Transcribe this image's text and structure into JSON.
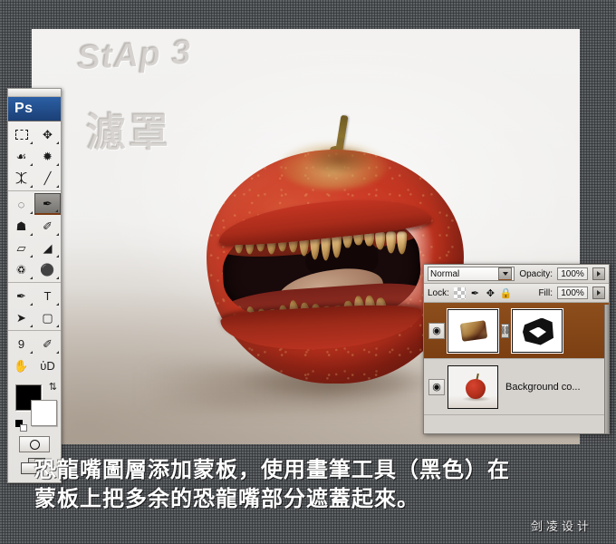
{
  "app": {
    "logo": "Ps"
  },
  "toolbar": {
    "groups": [
      {
        "name": "selection-tools",
        "rows": [
          [
            {
              "name": "rectangular-marquee-tool",
              "icon": "marquee-icon",
              "glyph": "",
              "corner": true,
              "active": false
            },
            {
              "name": "move-tool",
              "icon": "move-icon",
              "glyph": "✥",
              "corner": true,
              "active": false
            }
          ],
          [
            {
              "name": "lasso-tool",
              "icon": "lasso-icon",
              "glyph": "☙",
              "corner": true,
              "active": false
            },
            {
              "name": "magic-wand-tool",
              "icon": "magic-wand-icon",
              "glyph": "✹",
              "corner": true,
              "active": false
            }
          ],
          [
            {
              "name": "crop-tool",
              "icon": "crop-icon",
              "glyph": "⯰",
              "corner": true,
              "active": false
            },
            {
              "name": "slice-tool",
              "icon": "knife-icon",
              "glyph": "╱",
              "corner": true,
              "active": false
            }
          ]
        ]
      },
      {
        "name": "retouch-paint-tools",
        "rows": [
          [
            {
              "name": "healing-brush-tool",
              "icon": "patch-icon",
              "glyph": "◌",
              "corner": true,
              "active": false
            },
            {
              "name": "brush-tool",
              "icon": "brush-icon",
              "glyph": "✒",
              "corner": true,
              "active": true
            }
          ],
          [
            {
              "name": "clone-stamp-tool",
              "icon": "stamp-icon",
              "glyph": "☗",
              "corner": true,
              "active": false
            },
            {
              "name": "history-brush-tool",
              "icon": "history-brush-icon",
              "glyph": "✐",
              "corner": true,
              "active": false
            }
          ],
          [
            {
              "name": "eraser-tool",
              "icon": "eraser-icon",
              "glyph": "▱",
              "corner": true,
              "active": false
            },
            {
              "name": "gradient-tool",
              "icon": "paint-bucket-icon",
              "glyph": "◢",
              "corner": true,
              "active": false
            }
          ],
          [
            {
              "name": "blur-tool",
              "icon": "blur-drop-icon",
              "glyph": "♽",
              "corner": true,
              "active": false
            },
            {
              "name": "dodge-tool",
              "icon": "dodge-icon",
              "glyph": "⚫",
              "corner": true,
              "active": false
            }
          ]
        ]
      },
      {
        "name": "vector-type-tools",
        "rows": [
          [
            {
              "name": "pen-tool",
              "icon": "pen-icon",
              "glyph": "✒",
              "corner": true,
              "active": false
            },
            {
              "name": "type-tool",
              "icon": "text-icon",
              "glyph": "T",
              "corner": true,
              "active": false
            }
          ],
          [
            {
              "name": "path-selection-tool",
              "icon": "arrow-pointer-icon",
              "glyph": "➤",
              "corner": true,
              "active": false
            },
            {
              "name": "shape-tool",
              "icon": "rounded-rect-icon",
              "glyph": "▢",
              "corner": true,
              "active": false
            }
          ]
        ]
      },
      {
        "name": "navigation-tools",
        "rows": [
          [
            {
              "name": "notes-tool",
              "icon": "note-icon",
              "glyph": "὜9",
              "corner": true,
              "active": false
            },
            {
              "name": "eyedropper-tool",
              "icon": "eyedropper-icon",
              "glyph": "✐",
              "corner": true,
              "active": false
            }
          ],
          [
            {
              "name": "hand-tool",
              "icon": "hand-icon",
              "glyph": "✋",
              "corner": false,
              "active": false
            },
            {
              "name": "zoom-tool",
              "icon": "magnifier-icon",
              "glyph": "ὐD",
              "corner": false,
              "active": false
            }
          ]
        ]
      }
    ],
    "swatches": {
      "foreground_color": "#000000",
      "background_color": "#ffffff",
      "swap_icon": "swap-colors-icon",
      "default_icon": "default-colors-icon"
    },
    "quick_mask_icon": "quick-mask-icon",
    "screen_mode_icon": "screen-mode-icon"
  },
  "canvas": {
    "emboss_step_text": "StAp 3",
    "emboss_cn_text": "濾罩"
  },
  "layers_panel": {
    "blend_mode": "Normal",
    "opacity_label": "Opacity:",
    "opacity_value": "100%",
    "lock_label": "Lock:",
    "fill_label": "Fill:",
    "fill_value": "100%",
    "lock_icons": [
      {
        "name": "lock-transparent-pixels-icon",
        "glyph": "▒"
      },
      {
        "name": "lock-image-pixels-icon",
        "glyph": "✒"
      },
      {
        "name": "lock-position-icon",
        "glyph": "✥"
      },
      {
        "name": "lock-all-icon",
        "glyph": "🔒"
      }
    ],
    "layers": [
      {
        "name": "",
        "visible": true,
        "selected": true,
        "has_mask": true,
        "eye_icon": "eye-icon",
        "link_icon": "link-icon",
        "thumb_kind": "transparent-dinosaur-mouth",
        "mask_kind": "black-white-mask"
      },
      {
        "name": "Background co...",
        "visible": true,
        "selected": false,
        "has_mask": false,
        "eye_icon": "eye-icon",
        "thumb_kind": "apple-photo"
      }
    ]
  },
  "caption": {
    "line1": "恐龍嘴圖層添加蒙板，使用畫筆工具（黑色）在",
    "line2": "蒙板上把多余的恐龍嘴部分遮蓋起來。"
  },
  "watermark": {
    "text": "剑凌设计"
  }
}
